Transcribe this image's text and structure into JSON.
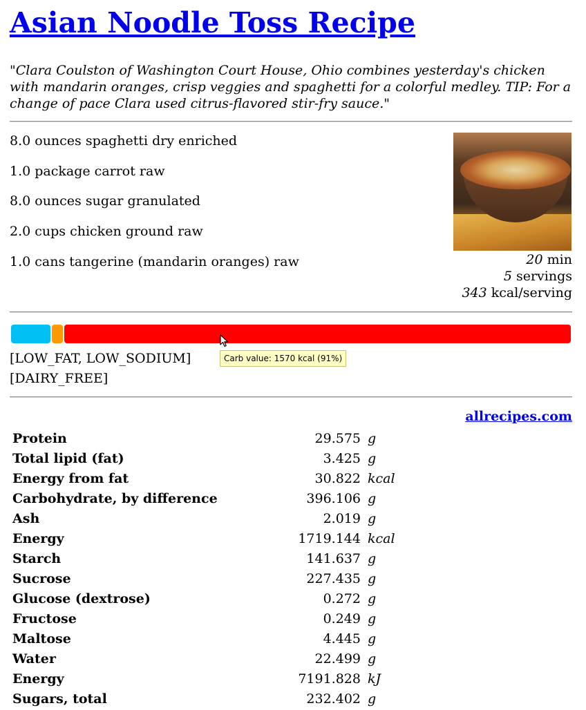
{
  "recipe": {
    "title": "Asian Noodle Toss Recipe",
    "description": "\"Clara Coulston of Washington Court House, Ohio combines yesterday's chicken with mandarin oranges, crisp veggies and spaghetti for a colorful medley. TIP: For a change of pace Clara used citrus-flavored stir-fry sauce.\"",
    "ingredients": [
      "8.0 ounces spaghetti dry enriched",
      "1.0 package carrot raw",
      "8.0 ounces sugar granulated",
      "2.0 cups chicken ground raw",
      "1.0 cans tangerine (mandarin oranges) raw"
    ],
    "time_value": "20",
    "time_unit": "min",
    "servings_value": "5",
    "servings_unit": "servings",
    "kcal_value": "343",
    "kcal_unit": "kcal/serving"
  },
  "energy_bar": {
    "segments": [
      {
        "name": "protein",
        "color": "#00bff3",
        "fraction": 0.07
      },
      {
        "name": "fat",
        "color": "#ff9900",
        "fraction": 0.02
      },
      {
        "name": "carb",
        "color": "#ff0000",
        "fraction": 0.91
      }
    ],
    "tooltip": "Carb value: 1570 kcal (91%)"
  },
  "labels": {
    "line1": "[LOW_FAT, LOW_SODIUM]",
    "line2": "[DAIRY_FREE]"
  },
  "source": {
    "link_text": "allrecipes.com"
  },
  "nutrients": [
    {
      "name": "Protein",
      "value": "29.575",
      "unit": "g"
    },
    {
      "name": "Total lipid (fat)",
      "value": "3.425",
      "unit": "g"
    },
    {
      "name": "Energy from fat",
      "value": "30.822",
      "unit": "kcal"
    },
    {
      "name": "Carbohydrate, by difference",
      "value": "396.106",
      "unit": "g"
    },
    {
      "name": "Ash",
      "value": "2.019",
      "unit": "g"
    },
    {
      "name": "Energy",
      "value": "1719.144",
      "unit": "kcal"
    },
    {
      "name": "Starch",
      "value": "141.637",
      "unit": "g"
    },
    {
      "name": "Sucrose",
      "value": "227.435",
      "unit": "g"
    },
    {
      "name": "Glucose (dextrose)",
      "value": "0.272",
      "unit": "g"
    },
    {
      "name": "Fructose",
      "value": "0.249",
      "unit": "g"
    },
    {
      "name": "Maltose",
      "value": "4.445",
      "unit": "g"
    },
    {
      "name": "Water",
      "value": "22.499",
      "unit": "g"
    },
    {
      "name": "Energy",
      "value": "7191.828",
      "unit": "kJ"
    },
    {
      "name": "Sugars, total",
      "value": "232.402",
      "unit": "g"
    }
  ]
}
